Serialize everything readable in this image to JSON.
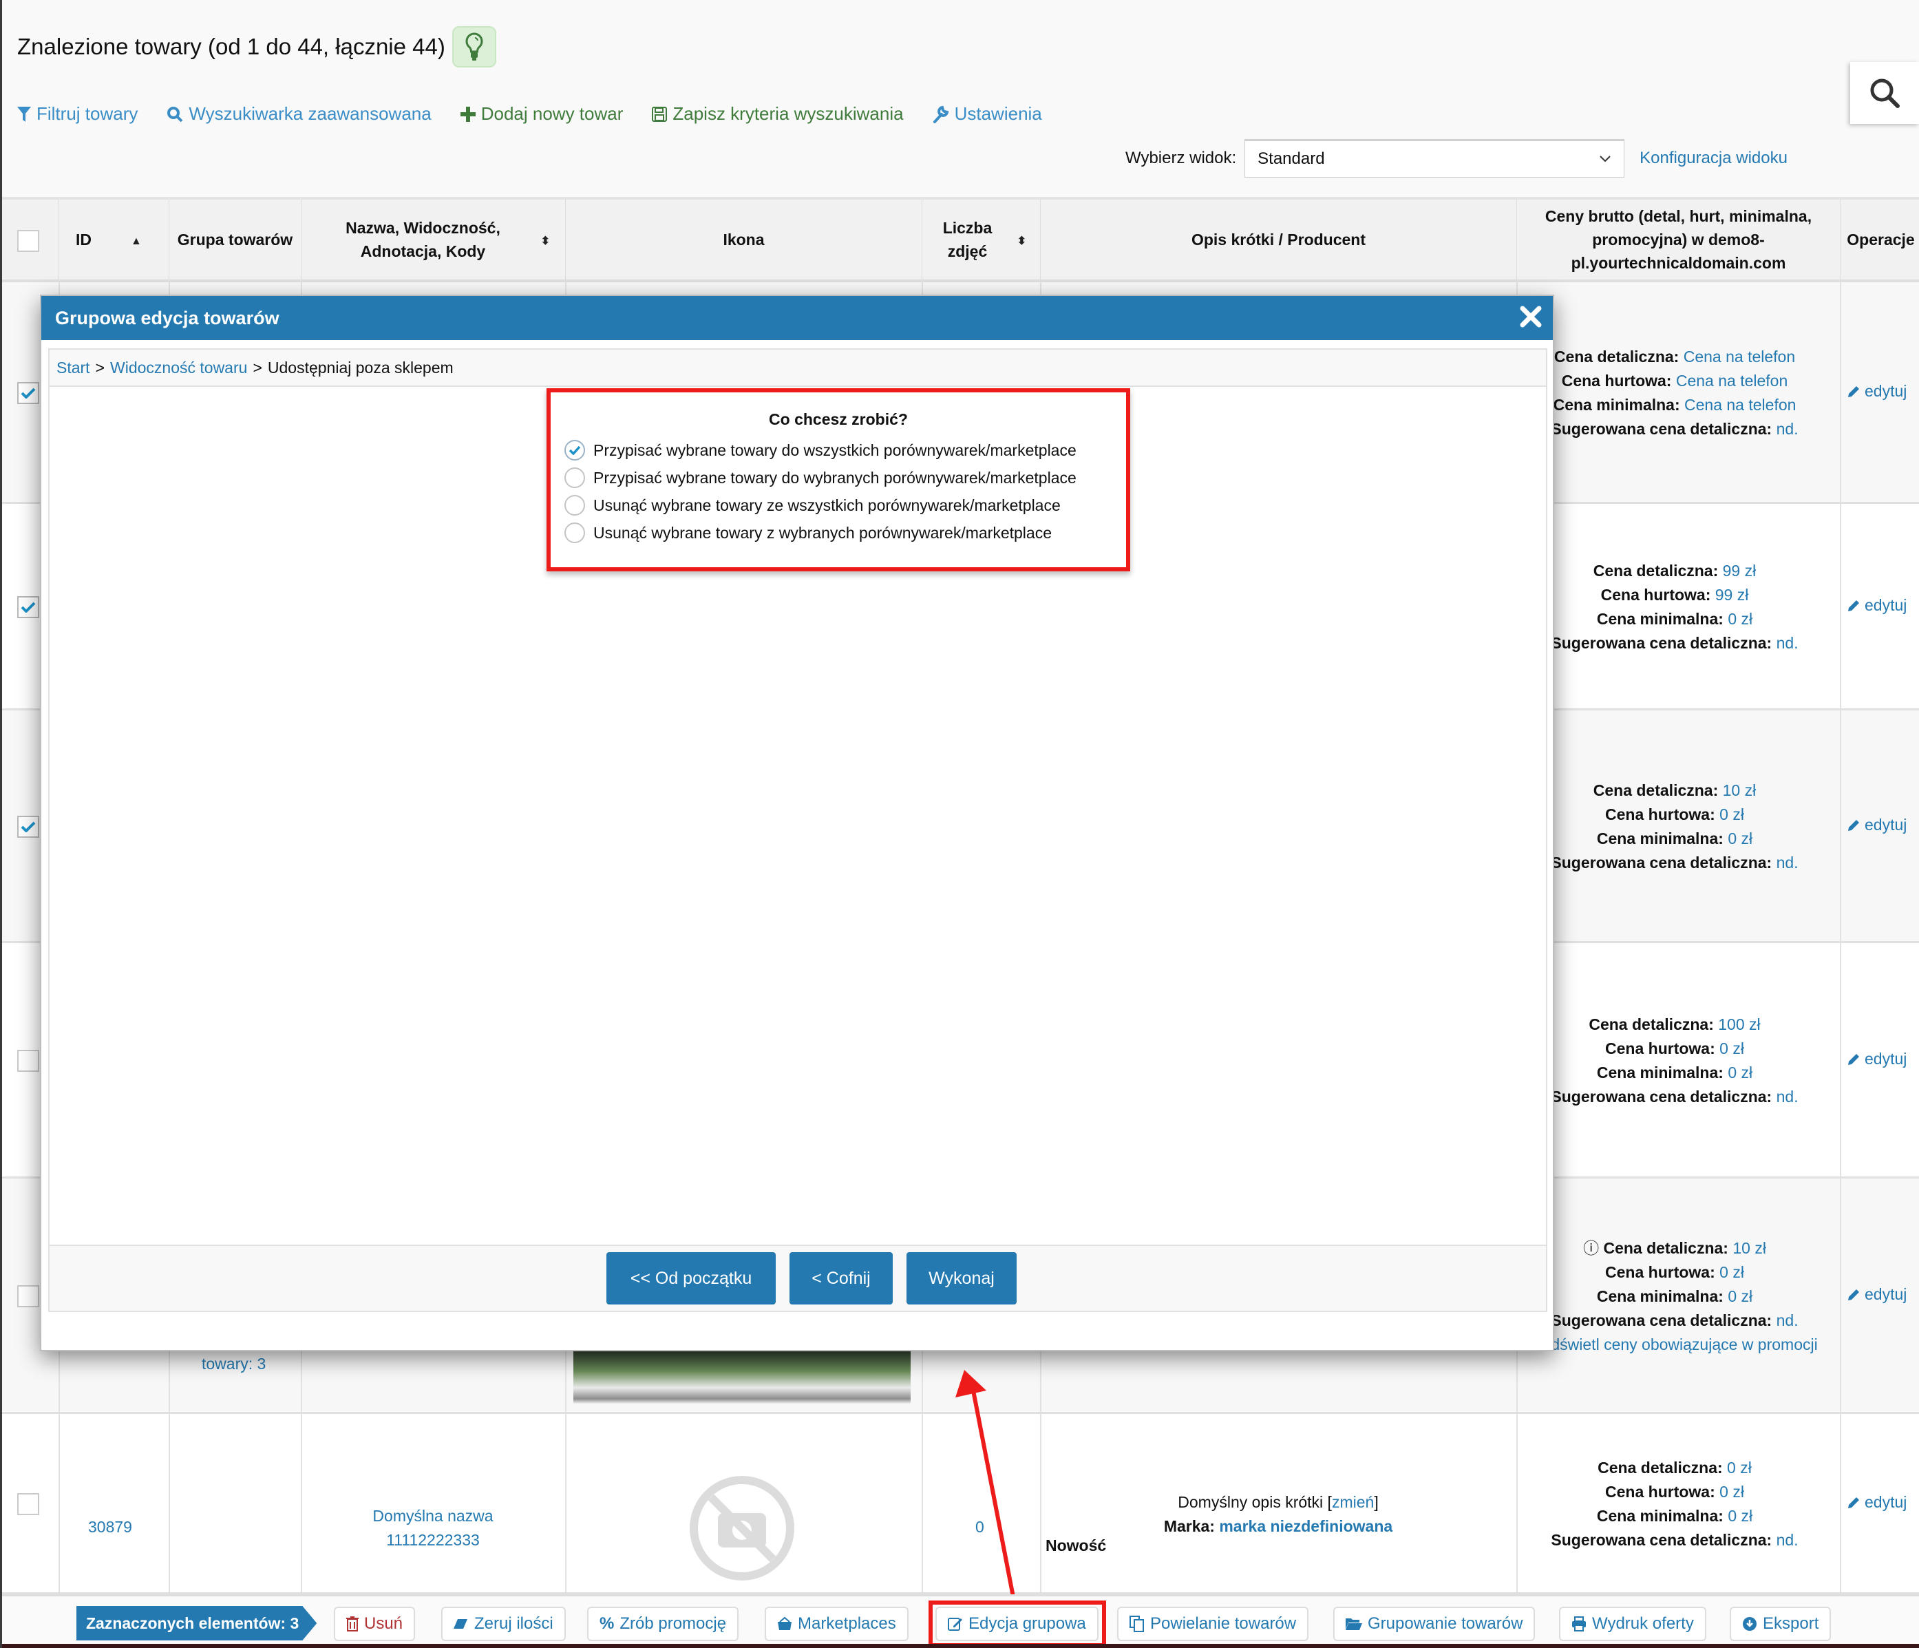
{
  "header": {
    "title": "Znalezione towary (od 1 do 44, łącznie 44)",
    "hint_icon": "lightbulb-icon"
  },
  "toolbar": {
    "filter": "Filtruj towary",
    "advanced_search": "Wyszukiwarka zaawansowana",
    "add_product": "Dodaj nowy towar",
    "save_criteria": "Zapisz kryteria wyszukiwania",
    "settings": "Ustawienia"
  },
  "view": {
    "label": "Wybierz widok:",
    "selected": "Standard",
    "config_link": "Konfiguracja widoku"
  },
  "table": {
    "headers": {
      "id": "ID",
      "group": "Grupa towarów",
      "name": "Nazwa, Widoczność, Adnotacja, Kody",
      "icon": "Ikona",
      "photos": "Liczba zdjęć",
      "description": "Opis krótki / Producent",
      "prices": "Ceny brutto (detal, hurt, minimalna, promocyjna) w demo8-pl.yourtechnicaldomain.com",
      "operations": "Operacje"
    },
    "price_labels": {
      "retail": "Cena detaliczna:",
      "wholesale": "Cena hurtowa:",
      "minimal": "Cena minimalna:",
      "suggested": "Sugerowana cena detaliczna:"
    },
    "edit_label": "edytuj",
    "rows": [
      {
        "checked": true,
        "retail": "Cena na telefon",
        "wholesale": "Cena na telefon",
        "minimal": "Cena na telefon",
        "suggested": "nd."
      },
      {
        "checked": true,
        "retail": "99 zł",
        "wholesale": "99 zł",
        "minimal": "0 zł",
        "suggested": "nd."
      },
      {
        "checked": true,
        "retail": "10 zł",
        "wholesale": "0 zł",
        "minimal": "0 zł",
        "suggested": "nd."
      },
      {
        "checked": false,
        "retail": "100 zł",
        "wholesale": "0 zł",
        "minimal": "0 zł",
        "suggested": "nd."
      },
      {
        "checked": false,
        "retail": "10 zł",
        "wholesale": "0 zł",
        "minimal": "0 zł",
        "suggested": "nd.",
        "promo_link": "Podświetl ceny obowiązujące w promocji",
        "group_text": "towary: 3"
      },
      {
        "checked": false,
        "id": "30879",
        "name": "Domyślna nazwa",
        "code": "11112222333",
        "photos": "0",
        "description": "Domyślny opis krótki",
        "change_link": "zmień",
        "brand_label": "Marka:",
        "brand": "marka niezdefiniowana",
        "badge": "Nowość",
        "retail": "0 zł",
        "wholesale": "0 zł",
        "minimal": "0 zł",
        "suggested": "nd."
      }
    ]
  },
  "modal": {
    "title": "Grupowa edycja towarów",
    "breadcrumb": [
      "Start",
      "Widoczność towaru",
      "Udostępniaj poza sklepem"
    ],
    "question": "Co chcesz zrobić?",
    "options": [
      {
        "label": "Przypisać wybrane towary do wszystkich porównywarek/marketplace",
        "selected": true
      },
      {
        "label": "Przypisać wybrane towary do wybranych porównywarek/marketplace",
        "selected": false
      },
      {
        "label": "Usunąć wybrane towary ze wszystkich porównywarek/marketplace",
        "selected": false
      },
      {
        "label": "Usunąć wybrane towary z wybranych porównywarek/marketplace",
        "selected": false
      }
    ],
    "buttons": {
      "restart": "<< Od początku",
      "back": "< Cofnij",
      "execute": "Wykonaj"
    }
  },
  "bottom_bar": {
    "selected_count": "Zaznaczonych elementów: 3",
    "delete": "Usuń",
    "reset_qty": "Zeruj ilości",
    "promotion": "Zrób promocję",
    "marketplaces": "Marketplaces",
    "group_edit": "Edycja grupowa",
    "duplicate": "Powielanie towarów",
    "grouping": "Grupowanie towarów",
    "print_offer": "Wydruk oferty",
    "export": "Eksport"
  },
  "colors": {
    "accent": "#2479b1",
    "annotation_red": "#ee1b1b",
    "green": "#3f7b3b"
  }
}
